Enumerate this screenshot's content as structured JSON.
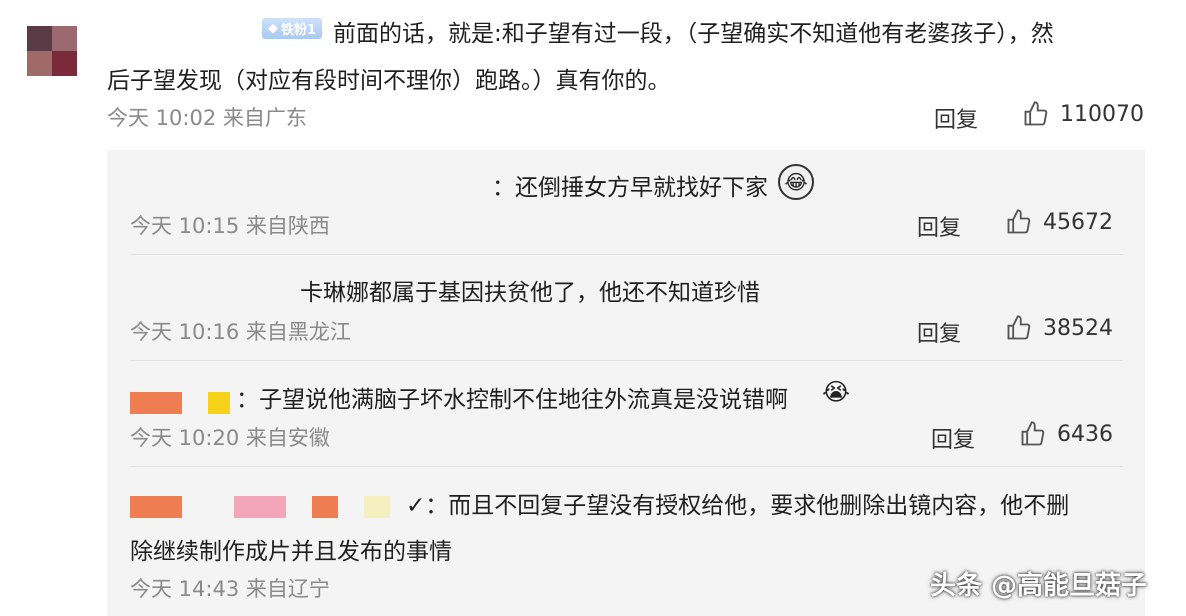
{
  "top_comment": {
    "badge": "铁粉1",
    "text_line1": "前面的话，就是:和子望有过一段，（子望确实不知道他有老婆孩子），然",
    "text_line2": "后子望发现（对应有段时间不理你）跑路。）真有你的。",
    "meta": "今天 10:02 来自广东",
    "reply_label": "回复",
    "likes": "110070"
  },
  "replies": [
    {
      "text": "：还倒捶女方早就找好下家",
      "emoji": "crying-laughing-emoji",
      "meta": "今天 10:15 来自陕西",
      "reply_label": "回复",
      "likes": "45672"
    },
    {
      "text": "卡琳娜都属于基因扶贫他了，他还不知道珍惜",
      "meta": "今天 10:16 来自黑龙江",
      "reply_label": "回复",
      "likes": "38524"
    },
    {
      "text": "：子望说他满脑子坏水控制不住地往外流真是没说错啊",
      "emoji": "crying-emoji",
      "meta": "今天 10:20 来自安徽",
      "reply_label": "回复",
      "likes": "6436"
    },
    {
      "text_line1": "✓：而且不回复子望没有授权给他，要求他删除出镜内容，他不删",
      "text_line2": "除继续制作成片并且发布的事情",
      "meta": "今天 14:43 来自辽宁"
    }
  ],
  "watermark": "头条 @高能旦菇子",
  "colors": {
    "panel_bg": "#f4f4f4",
    "badge": "#a9c9f3",
    "orange_block": "#ef7d52",
    "pink_block": "#f2a6b8",
    "yellow_block": "#f5d21c"
  }
}
